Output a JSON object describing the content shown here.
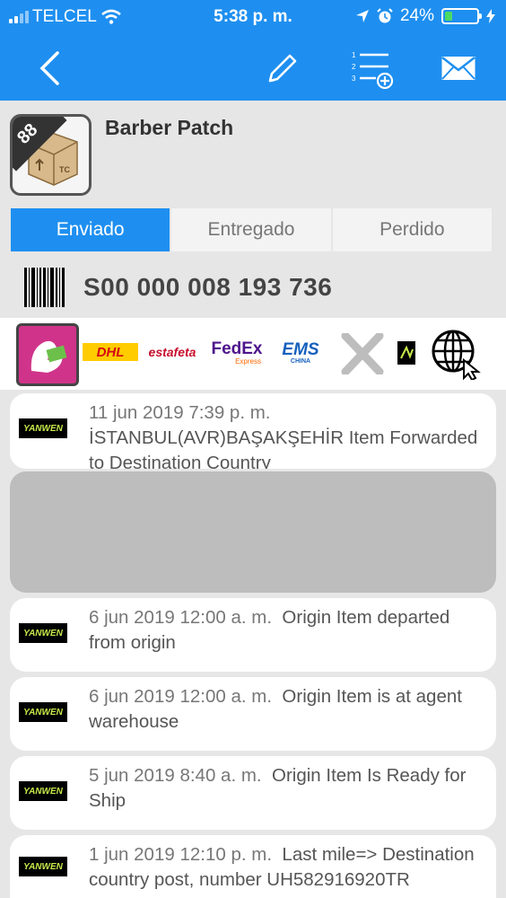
{
  "status_bar": {
    "carrier": "TELCEL",
    "time": "5:38 p. m.",
    "battery": "24%",
    "battery_level": 0.24
  },
  "nav": {
    "icons": [
      "back-arrow-icon",
      "pencil-icon",
      "numbered-list-add-icon",
      "envelope-icon"
    ]
  },
  "package": {
    "badge_count": "88",
    "name": "Barber Patch"
  },
  "segment": {
    "tabs": [
      "Enviado",
      "Entregado",
      "Perdido"
    ],
    "selected": "Enviado"
  },
  "tracking": {
    "number": "S00 000 008 193 736"
  },
  "carriers": [
    {
      "name": "postal-service-logo"
    },
    {
      "name": "dhl-logo",
      "text": "DHL"
    },
    {
      "name": "estafeta-logo",
      "text": "estafeta"
    },
    {
      "name": "fedex-logo",
      "text": "FedEx",
      "sub": "Express"
    },
    {
      "name": "ems-logo",
      "text": "EMS",
      "sub": "CHINA"
    },
    {
      "name": "x-logo",
      "text": "X"
    },
    {
      "name": "yanwen-small-logo"
    },
    {
      "name": "web-globe-icon"
    }
  ],
  "events": [
    {
      "logo": "YANWEN",
      "date": "11 jun 2019 7:39 p. m.",
      "desc": "İSTANBUL(AVR)BAŞAKŞEHİR Item Forwarded to Destination Country"
    },
    {
      "logo": "YANWEN",
      "date": "6 jun 2019 12:00 a. m.",
      "desc": "Origin Item departed from origin"
    },
    {
      "logo": "YANWEN",
      "date": "6 jun 2019 12:00 a. m.",
      "desc": "Origin Item is at agent warehouse"
    },
    {
      "logo": "YANWEN",
      "date": "5 jun 2019 8:40 a. m.",
      "desc": "Origin Item Is Ready for Ship"
    },
    {
      "logo": "YANWEN",
      "date": "1 jun 2019 12:10 p. m.",
      "desc": "Last mile=> Destination country post, number UH582916920TR"
    }
  ],
  "colors": {
    "accent": "#1e8ff0",
    "background": "#e6e6e6"
  }
}
